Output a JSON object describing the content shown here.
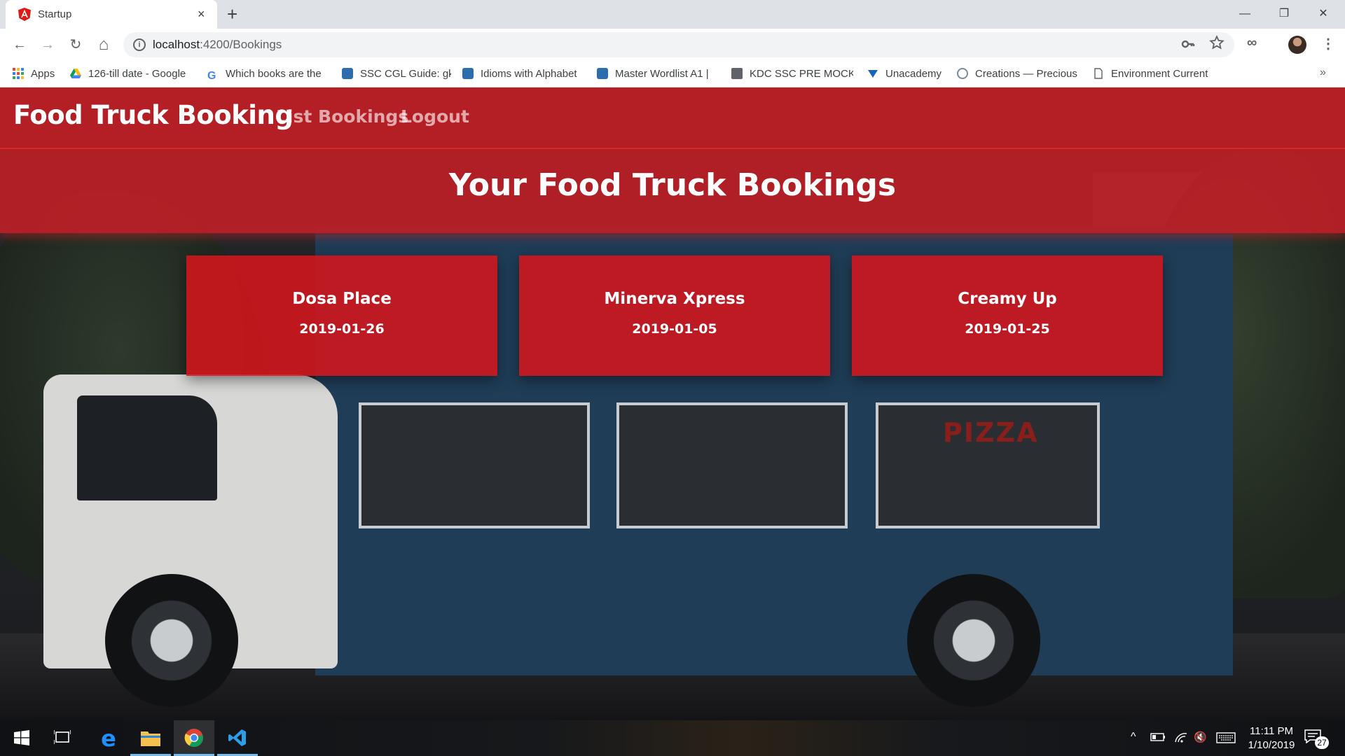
{
  "browser": {
    "tab_title": "Startup",
    "tab_close": "×",
    "new_tab": "+",
    "url_host": "localhost",
    "url_rest": ":4200/Bookings",
    "window_controls": {
      "minimize": "—",
      "maximize": "❐",
      "close": "✕"
    }
  },
  "toolbar": {
    "back": "←",
    "forward": "→",
    "reload": "↻",
    "home": "⌂",
    "info": "i",
    "menu": "⋮",
    "extension": "∞"
  },
  "bookmarks": [
    {
      "label": "Apps",
      "icon": "apps-grid-icon"
    },
    {
      "label": "126-till date - Google",
      "icon": "google-drive-icon"
    },
    {
      "label": "Which books are the",
      "icon": "google-icon"
    },
    {
      "label": "SSC CGL Guide: gk",
      "icon": "quora-icon"
    },
    {
      "label": "Idioms with Alphabet",
      "icon": "quora-icon"
    },
    {
      "label": "Master Wordlist A1 |",
      "icon": "quora-icon"
    },
    {
      "label": "KDC SSC PRE MOCK",
      "icon": "folder-icon"
    },
    {
      "label": "Unacademy",
      "icon": "unacademy-icon"
    },
    {
      "label": "Creations — Precious",
      "icon": "site-icon"
    },
    {
      "label": "Environment Current",
      "icon": "page-icon"
    }
  ],
  "bookmarks_overflow": "»",
  "app": {
    "brand": "Food Truck Booking",
    "nav": [
      {
        "label": "List Bookings"
      },
      {
        "label": "Logout"
      }
    ],
    "heading": "Your Food Truck Bookings",
    "background_sign": "PIZZA",
    "bookings": [
      {
        "name": "Dosa Place",
        "date": "2019-01-26"
      },
      {
        "name": "Minerva Xpress",
        "date": "2019-01-05"
      },
      {
        "name": "Creamy Up",
        "date": "2019-01-25"
      }
    ],
    "colors": {
      "primary_red": "#c81e26",
      "card_red": "#d4161c"
    }
  },
  "taskbar": {
    "apps": [
      {
        "name": "start",
        "icon": "windows-start-icon"
      },
      {
        "name": "task-view",
        "icon": "task-view-icon"
      },
      {
        "name": "edge",
        "icon": "edge-icon"
      },
      {
        "name": "file-explorer",
        "icon": "folder-icon"
      },
      {
        "name": "chrome",
        "icon": "chrome-icon"
      },
      {
        "name": "vscode",
        "icon": "vscode-icon"
      }
    ],
    "tray": {
      "chevron": "^",
      "volume": "🔇"
    },
    "time": "11:11 PM",
    "date": "1/10/2019",
    "notification_count": "27"
  }
}
